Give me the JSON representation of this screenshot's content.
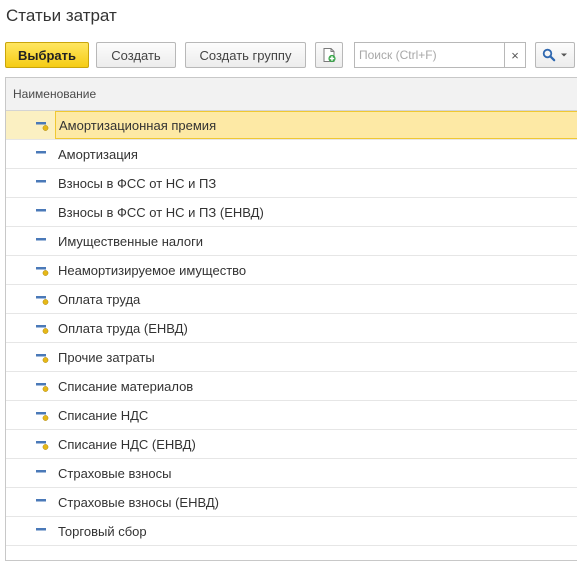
{
  "window": {
    "title": "Статьи затрат"
  },
  "toolbar": {
    "select_label": "Выбрать",
    "create_label": "Создать",
    "create_group_label": "Создать группу",
    "search_placeholder": "Поиск (Ctrl+F)",
    "clear_label": "×"
  },
  "grid": {
    "column_header": "Наименование",
    "rows": [
      {
        "name": "Амортизационная премия",
        "icon": "predefined-item-icon",
        "selected": true
      },
      {
        "name": "Амортизация",
        "icon": "item-icon"
      },
      {
        "name": "Взносы в ФСС от НС и ПЗ",
        "icon": "item-icon"
      },
      {
        "name": "Взносы в ФСС от НС и ПЗ (ЕНВД)",
        "icon": "item-icon"
      },
      {
        "name": "Имущественные налоги",
        "icon": "item-icon"
      },
      {
        "name": "Неамортизируемое имущество",
        "icon": "predefined-item-icon"
      },
      {
        "name": "Оплата труда",
        "icon": "predefined-item-icon"
      },
      {
        "name": "Оплата труда (ЕНВД)",
        "icon": "predefined-item-icon"
      },
      {
        "name": "Прочие затраты",
        "icon": "predefined-item-icon"
      },
      {
        "name": "Списание материалов",
        "icon": "predefined-item-icon"
      },
      {
        "name": "Списание НДС",
        "icon": "predefined-item-icon"
      },
      {
        "name": "Списание НДС (ЕНВД)",
        "icon": "predefined-item-icon"
      },
      {
        "name": "Страховые взносы",
        "icon": "item-icon"
      },
      {
        "name": "Страховые взносы (ЕНВД)",
        "icon": "item-icon"
      },
      {
        "name": "Торговый сбор",
        "icon": "item-icon"
      }
    ]
  },
  "colors": {
    "primary_button": "#f5cc14",
    "selected_row": "#fde9a5",
    "icon_dash": "#4a79b8",
    "icon_dot": "#e6b817"
  }
}
